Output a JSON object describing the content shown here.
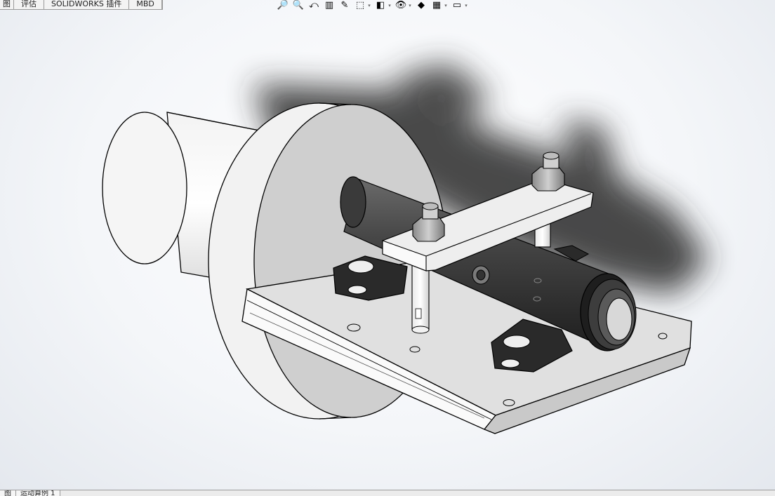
{
  "top_tabs": [
    "图",
    "评估",
    "SOLIDWORKS 插件",
    "MBD"
  ],
  "hud_icons": [
    {
      "name": "zoom-to-fit-icon",
      "glyph": "🔎"
    },
    {
      "name": "zoom-to-area-icon",
      "glyph": "🔍"
    },
    {
      "name": "previous-view-icon",
      "glyph": "⤺"
    },
    {
      "name": "section-view-icon",
      "glyph": "▥"
    },
    {
      "name": "dynamic-annotation-icon",
      "glyph": "✎"
    },
    {
      "name": "view-orientation-icon",
      "glyph": "⬚",
      "dropdown": true
    },
    {
      "name": "display-style-icon",
      "glyph": "◧",
      "dropdown": true
    },
    {
      "name": "hide-show-items-icon",
      "glyph": "👁",
      "dropdown": true
    },
    {
      "name": "edit-appearance-icon",
      "glyph": "◆"
    },
    {
      "name": "apply-scene-icon",
      "glyph": "▦",
      "dropdown": true
    },
    {
      "name": "view-settings-icon",
      "glyph": "▭",
      "dropdown": true
    }
  ],
  "bottom_tabs": [
    "图",
    "运动算例 1"
  ]
}
